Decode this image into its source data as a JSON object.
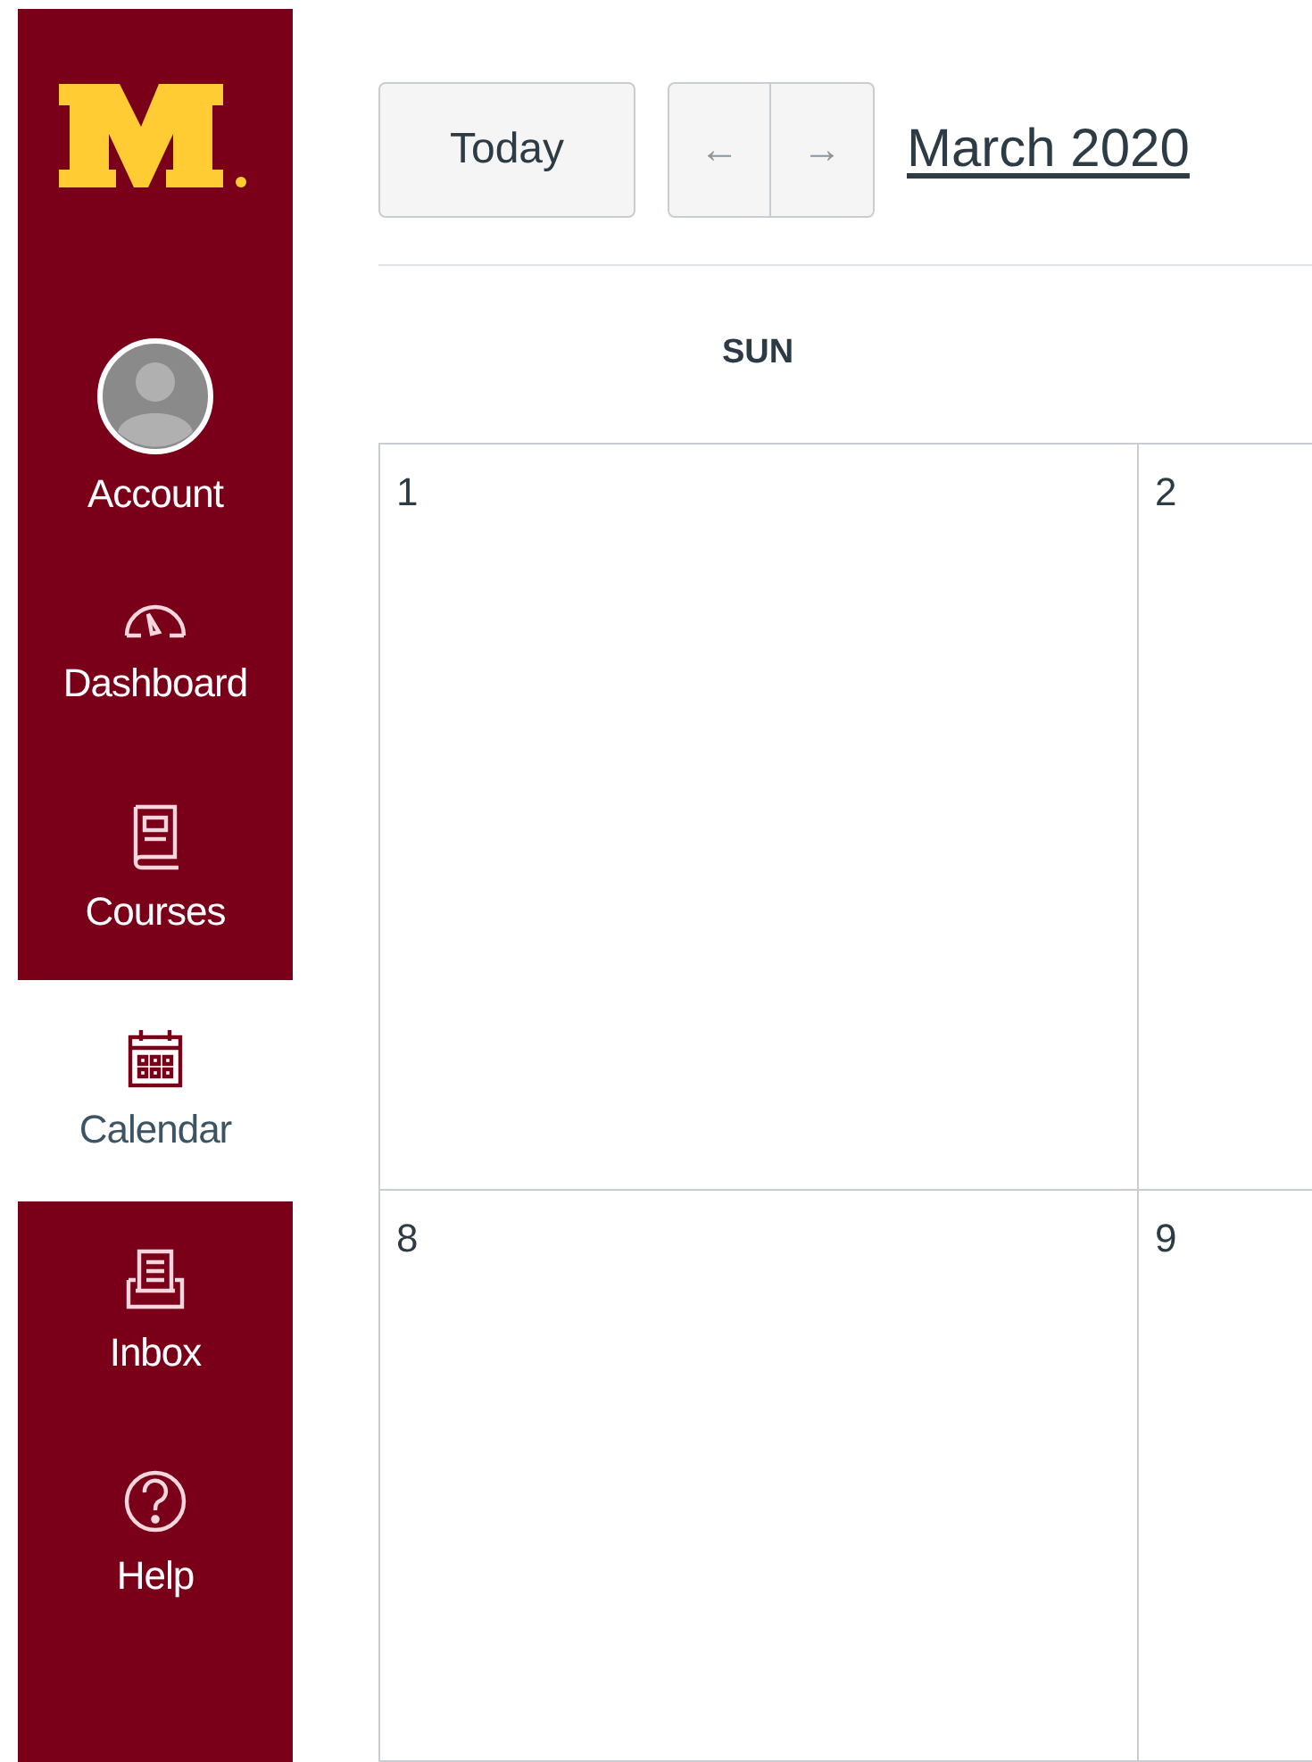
{
  "sidebar": {
    "items": [
      {
        "kind": "account",
        "label": "Account",
        "selected": false
      },
      {
        "kind": "dashboard",
        "label": "Dashboard",
        "selected": false
      },
      {
        "kind": "courses",
        "label": "Courses",
        "selected": false
      },
      {
        "kind": "calendar",
        "label": "Calendar",
        "selected": true
      },
      {
        "kind": "inbox",
        "label": "Inbox",
        "selected": false
      },
      {
        "kind": "help",
        "label": "Help",
        "selected": false
      }
    ]
  },
  "toolbar": {
    "today_button": "Today",
    "prev_button": "←",
    "next_button": "→",
    "title": "March 2020"
  },
  "calendar": {
    "columns": [
      "SUN"
    ],
    "rows": [
      [
        "1",
        "2"
      ],
      [
        "8",
        "9"
      ]
    ]
  }
}
